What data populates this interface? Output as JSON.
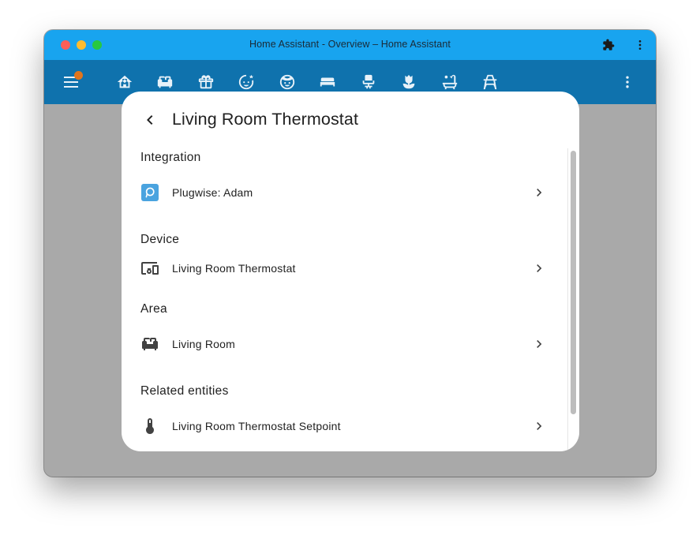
{
  "window": {
    "title": "Home Assistant - Overview – Home Assistant"
  },
  "titlebar_icons": [
    "puzzle-icon",
    "more-vertical-icon"
  ],
  "toolbar": {
    "view_icons": [
      "home-heart-icon",
      "sofa-icon",
      "gift-icon",
      "baby-face-icon",
      "face-icon",
      "bed-icon",
      "office-chair-icon",
      "flower-tulip-icon",
      "bathtub-icon",
      "transmission-tower-icon"
    ]
  },
  "dialog": {
    "title": "Living Room Thermostat",
    "sections": {
      "integration": {
        "label": "Integration",
        "item": "Plugwise: Adam"
      },
      "device": {
        "label": "Device",
        "item": "Living Room Thermostat"
      },
      "area": {
        "label": "Area",
        "item": "Living Room"
      },
      "related": {
        "label": "Related entities",
        "item": "Living Room Thermostat Setpoint"
      }
    }
  },
  "colors": {
    "titlebar": "#18a4ef",
    "toolbar": "#0f72ad",
    "backdrop": "#a9a9a9",
    "badge": "#e0751d",
    "plugwise": "#4aa3df"
  }
}
